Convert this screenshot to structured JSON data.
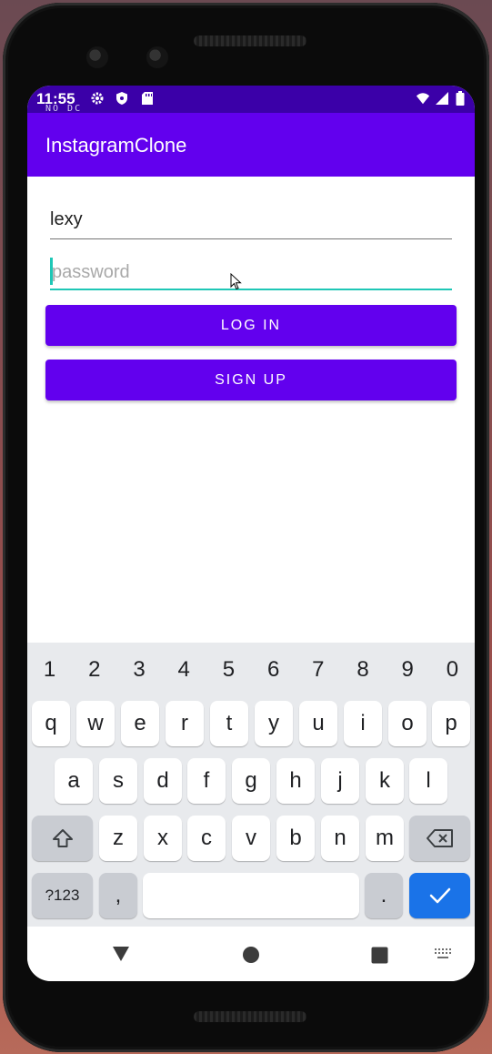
{
  "status_bar": {
    "time": "11:55",
    "carrier_note": "NO DC",
    "icons": [
      "gear-icon",
      "shield-icon",
      "sd-card-icon",
      "wifi-icon",
      "signal-icon",
      "battery-icon"
    ]
  },
  "app_bar": {
    "title": "InstagramClone"
  },
  "form": {
    "username_value": "lexy",
    "password_placeholder": "password",
    "login_label": "LOG IN",
    "signup_label": "SIGN UP"
  },
  "keyboard": {
    "number_row": [
      "1",
      "2",
      "3",
      "4",
      "5",
      "6",
      "7",
      "8",
      "9",
      "0"
    ],
    "row1": [
      "q",
      "w",
      "e",
      "r",
      "t",
      "y",
      "u",
      "i",
      "o",
      "p"
    ],
    "row2": [
      "a",
      "s",
      "d",
      "f",
      "g",
      "h",
      "j",
      "k",
      "l"
    ],
    "row3": [
      "z",
      "x",
      "c",
      "v",
      "b",
      "n",
      "m"
    ],
    "symbols_label": "?123",
    "comma_label": ",",
    "period_label": "."
  },
  "nav_bar": {
    "icons": [
      "back-icon",
      "home-icon",
      "recents-icon",
      "keyboard-switch-icon"
    ]
  },
  "colors": {
    "primary": "#6200ee",
    "status_bar": "#3b00a8",
    "accent": "#1fc7b6",
    "keyboard_enter": "#1a73e8"
  }
}
